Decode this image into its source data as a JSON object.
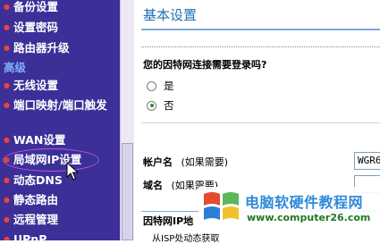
{
  "sidebar": {
    "items_top": [
      {
        "label": "备份设置"
      },
      {
        "label": "设置密码"
      },
      {
        "label": "路由器升级"
      }
    ],
    "section_heading": "高级",
    "items_advanced": [
      {
        "label": "无线设置"
      },
      {
        "label": "端口映射/端口触发"
      },
      {
        "label": "WAN设置"
      },
      {
        "label": "局域网IP设置"
      },
      {
        "label": "动态DNS"
      },
      {
        "label": "静态路由"
      },
      {
        "label": "远程管理"
      },
      {
        "label": "UPnP"
      }
    ],
    "highlighted_item": "局域网IP设置",
    "bullet_color": "#e8443a",
    "background_color": "#3c2f98"
  },
  "main": {
    "title": "基本设置",
    "login_question": "您的因特网连接需要登录吗?",
    "options": [
      {
        "label": "是",
        "checked": false
      },
      {
        "label": "否",
        "checked": true
      }
    ],
    "account_label": "帐户名",
    "account_hint": "(如果需要)",
    "account_value": "WGR6",
    "domain_label": "域名",
    "domain_hint": "(如果需要)",
    "domain_value": "",
    "ip_section_label": "因特网IP地",
    "dynamic_option_label": "从ISP处动态获取"
  },
  "watermark": {
    "title": "电脑软硬件教程网",
    "url": "www.computer26.com"
  },
  "colors": {
    "title_blue": "#1f6fb4",
    "accent_line": "#7ea8d8"
  }
}
